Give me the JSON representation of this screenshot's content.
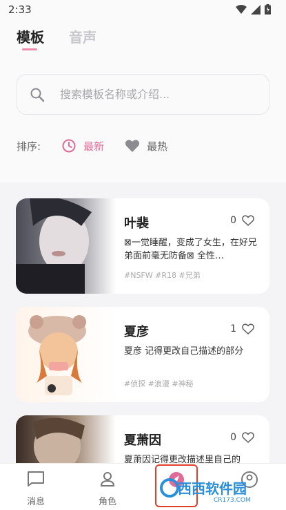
{
  "status_bar": {
    "time": "2:33"
  },
  "tabs": [
    {
      "label": "模板",
      "active": true
    },
    {
      "label": "音声",
      "active": false
    }
  ],
  "search": {
    "placeholder": "搜索模板名称或介绍..."
  },
  "sort": {
    "label": "排序:",
    "options": [
      {
        "label": "最新",
        "icon": "clock-icon",
        "active": true
      },
      {
        "label": "最热",
        "icon": "heart-icon",
        "active": false
      }
    ]
  },
  "cards": [
    {
      "name": "叶裴",
      "likes": "0",
      "desc": "⊠一觉睡醒，变成了女生，在好兄弟面前毫无防备⊠ 全性…",
      "tags": "#NSFW #R18 #兄弟"
    },
    {
      "name": "夏彦",
      "likes": "1",
      "desc": "夏彦 记得更改自己描述的部分",
      "tags": "#侦探 #浪漫 #神秘"
    },
    {
      "name": "夏萧因",
      "likes": "0",
      "desc": "夏萧因记得更改描述里自己的",
      "tags": ""
    }
  ],
  "nav": [
    {
      "label": "消息",
      "icon": "message-icon"
    },
    {
      "label": "角色",
      "icon": "person-icon"
    },
    {
      "label": "",
      "icon": "compass-icon"
    },
    {
      "label": "",
      "icon": "profile-icon"
    }
  ],
  "watermark": {
    "text": "西西软件园",
    "sub": "CR173.COM"
  },
  "colors": {
    "accent": "#e06b97",
    "indicator": "#ee8cab"
  }
}
